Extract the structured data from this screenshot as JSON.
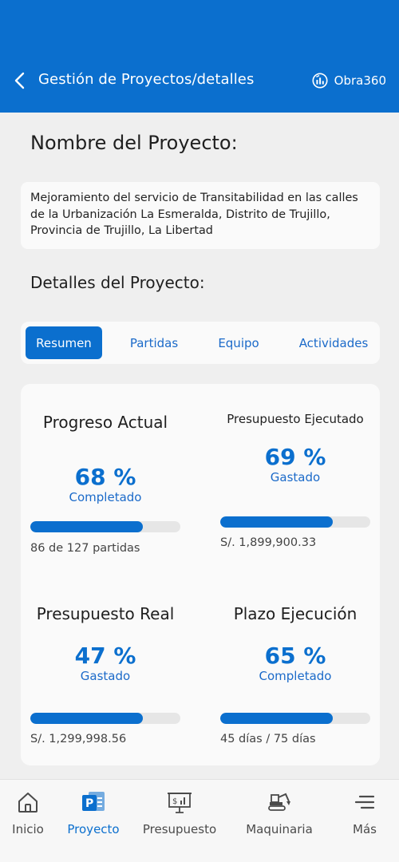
{
  "header": {
    "title": "Gestión de Proyectos/detalles",
    "brand": "Obra360",
    "back_icon": "chevron-left-icon",
    "brand_icon": "dashboard-gauge-icon"
  },
  "project": {
    "name_title": "Nombre del Proyecto:",
    "name": "Mejoramiento del servicio de Transitabilidad en las calles de la Urbanización La Esmeralda, Distrito de Trujillo, Provincia de Trujillo, La Libertad",
    "details_title": "Detalles del Proyecto:"
  },
  "tabs": [
    {
      "label": "Resumen",
      "active": true
    },
    {
      "label": "Partidas",
      "active": false
    },
    {
      "label": "Equipo",
      "active": false
    },
    {
      "label": "Actividades",
      "active": false
    }
  ],
  "stats": {
    "progreso": {
      "title": "Progreso Actual",
      "value": "68 %",
      "sub": "Completado",
      "fill": 0.75,
      "foot": "86 de 127 partidas"
    },
    "ejecutado": {
      "title": "Presupuesto Ejecutado",
      "value": "69 %",
      "sub": "Gastado",
      "fill": 0.75,
      "foot": "S/.  1,899,900.33"
    },
    "real": {
      "title": "Presupuesto Real",
      "value": "47 %",
      "sub": "Gastado",
      "fill": 0.75,
      "foot": "S/.  1,299,998.56"
    },
    "plazo": {
      "title": "Plazo Ejecución",
      "value": "65 %",
      "sub": "Completado",
      "fill": 0.75,
      "foot": "45 días / 75 días"
    }
  },
  "nav": [
    {
      "label": "Inicio",
      "icon": "home-icon",
      "active": false
    },
    {
      "label": "Proyecto",
      "icon": "project-icon",
      "active": true
    },
    {
      "label": "Presupuesto",
      "icon": "budget-board-icon",
      "active": false
    },
    {
      "label": "Maquinaria",
      "icon": "excavator-icon",
      "active": false
    },
    {
      "label": "Más",
      "icon": "menu-icon",
      "active": false
    }
  ],
  "colors": {
    "primary": "#0b6fce",
    "background": "#efefef",
    "card": "#fafafa"
  }
}
